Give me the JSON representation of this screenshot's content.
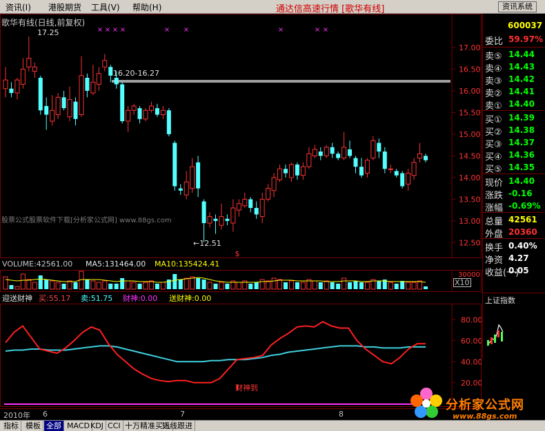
{
  "menu": {
    "items": [
      {
        "label": "资讯(I)",
        "left": 8
      },
      {
        "label": "港股期货",
        "left": 70
      },
      {
        "label": "工具(V)",
        "left": 132
      },
      {
        "label": "帮助(H)",
        "left": 192
      }
    ],
    "app_title": "通达信高速行情 [歌华有线]",
    "info_button": "资讯系统"
  },
  "chart": {
    "title": "歌华有线(日线,前复权)",
    "y_ticks": [
      "17.00",
      "16.50",
      "16.00",
      "15.50",
      "15.00",
      "14.50",
      "14.00",
      "13.50",
      "13.00",
      "12.50"
    ],
    "hi_label": "17.25",
    "lo_label": "←12.51",
    "zone_label": "16.20-16.27",
    "watermark": "股票公式股票软件下载[分析家公式网] www.88gs.com",
    "dollar_marker": "$"
  },
  "volume": {
    "volume": "VOLUME:42561.00",
    "ma5": "MA5:131464.00",
    "ma10": "MA10:135424.41",
    "scale_label": "X10",
    "tick_top": "30000"
  },
  "indicator": {
    "name": "迎送财神",
    "buy": "买:55.17",
    "sell": "卖:51.75",
    "caishen": "财神:0.00",
    "songcaishen": "送财神:0.00",
    "y_ticks": [
      "80.00",
      "60.00",
      "40.00",
      "20.00"
    ],
    "signal_text": "财神到"
  },
  "dates": {
    "year": "2010年",
    "m6": "6",
    "m7": "7",
    "m8": "8"
  },
  "quote": {
    "code": "600037",
    "rows": [
      {
        "label": "委比",
        "value": "59.97%",
        "color": "#ff3030"
      },
      {
        "label": "卖⑤",
        "value": "14.44",
        "color": "#00ff00"
      },
      {
        "label": "卖④",
        "value": "14.43",
        "color": "#00ff00"
      },
      {
        "label": "卖③",
        "value": "14.42",
        "color": "#00ff00"
      },
      {
        "label": "卖②",
        "value": "14.41",
        "color": "#00ff00"
      },
      {
        "label": "卖①",
        "value": "14.40",
        "color": "#00ff00"
      },
      {
        "label": "买①",
        "value": "14.39",
        "color": "#00ff00"
      },
      {
        "label": "买②",
        "value": "14.38",
        "color": "#00ff00"
      },
      {
        "label": "买③",
        "value": "14.37",
        "color": "#00ff00"
      },
      {
        "label": "买④",
        "value": "14.36",
        "color": "#00ff00"
      },
      {
        "label": "买⑤",
        "value": "14.35",
        "color": "#00ff00"
      },
      {
        "label": "现价",
        "value": "14.40",
        "color": "#00ff00"
      },
      {
        "label": "涨跌",
        "value": "-0.16",
        "color": "#00ff00"
      },
      {
        "label": "涨幅",
        "value": "-0.69%",
        "color": "#00ff00"
      },
      {
        "label": "总量",
        "value": "42561",
        "color": "#ffff00"
      },
      {
        "label": "外盘",
        "value": "20360",
        "color": "#ff3030"
      },
      {
        "label": "换手",
        "value": "0.40%",
        "color": "#ffffff"
      },
      {
        "label": "净资",
        "value": "4.27",
        "color": "#ffffff"
      },
      {
        "label": "收益(一)",
        "value": "0.05",
        "color": "#ffffff"
      }
    ]
  },
  "index_panel": {
    "title": "上证指数"
  },
  "logo": {
    "name": "分析家公式网",
    "url": "www.88gs.com"
  },
  "tabs": [
    "指标",
    "模板",
    "全部",
    "MACD",
    "KDJ",
    "CCI",
    "十万精准买入",
    "短线跟进"
  ],
  "colors": {
    "up": "#ff3333",
    "down": "#54ffff",
    "bg": "#000000",
    "grid": "#7a0000",
    "ma_line": "#40d0e0",
    "trade_line": "#ff2020",
    "marker": "#ff33ff"
  },
  "chart_data": {
    "type": "candlestick",
    "x_labels": [
      "2010年",
      "6",
      "7",
      "8"
    ],
    "ylim": [
      12.3,
      17.3
    ],
    "candles": [
      {
        "o": 16.05,
        "c": 16.25,
        "h": 16.55,
        "l": 15.85
      },
      {
        "o": 16.05,
        "c": 15.95,
        "h": 16.2,
        "l": 15.85
      },
      {
        "o": 15.95,
        "c": 16.25,
        "h": 16.3,
        "l": 15.8
      },
      {
        "o": 16.15,
        "c": 16.5,
        "h": 16.75,
        "l": 16.05
      },
      {
        "o": 16.55,
        "c": 16.75,
        "h": 17.25,
        "l": 16.45
      },
      {
        "o": 16.45,
        "c": 16.55,
        "h": 16.65,
        "l": 16.3
      },
      {
        "o": 16.3,
        "c": 15.55,
        "h": 16.35,
        "l": 15.45
      },
      {
        "o": 15.65,
        "c": 15.45,
        "h": 15.85,
        "l": 15.1
      },
      {
        "o": 15.3,
        "c": 15.55,
        "h": 15.9,
        "l": 15.2
      },
      {
        "o": 15.45,
        "c": 15.85,
        "h": 15.95,
        "l": 15.35
      },
      {
        "o": 15.85,
        "c": 15.6,
        "h": 16.0,
        "l": 15.55
      },
      {
        "o": 15.4,
        "c": 15.8,
        "h": 16.1,
        "l": 15.3
      },
      {
        "o": 15.75,
        "c": 15.35,
        "h": 15.85,
        "l": 15.2
      },
      {
        "o": 15.45,
        "c": 16.35,
        "h": 16.8,
        "l": 15.4
      },
      {
        "o": 16.3,
        "c": 16.0,
        "h": 16.4,
        "l": 15.85
      },
      {
        "o": 15.95,
        "c": 16.2,
        "h": 16.6,
        "l": 15.9
      },
      {
        "o": 16.15,
        "c": 16.4,
        "h": 16.55,
        "l": 16.0
      },
      {
        "o": 16.55,
        "c": 16.7,
        "h": 16.85,
        "l": 16.45
      },
      {
        "o": 16.55,
        "c": 16.35,
        "h": 16.6,
        "l": 16.2
      },
      {
        "o": 16.3,
        "c": 16.15,
        "h": 16.45,
        "l": 16.05
      },
      {
        "o": 16.15,
        "c": 15.3,
        "h": 16.2,
        "l": 15.25
      },
      {
        "o": 15.3,
        "c": 15.55,
        "h": 15.65,
        "l": 15.05
      },
      {
        "o": 15.55,
        "c": 15.65,
        "h": 15.7,
        "l": 15.45
      },
      {
        "o": 15.6,
        "c": 15.35,
        "h": 15.65,
        "l": 15.25
      },
      {
        "o": 15.35,
        "c": 15.55,
        "h": 15.6,
        "l": 15.3
      },
      {
        "o": 15.55,
        "c": 15.65,
        "h": 15.75,
        "l": 15.5
      },
      {
        "o": 15.6,
        "c": 15.45,
        "h": 15.7,
        "l": 15.4
      },
      {
        "o": 15.45,
        "c": 15.55,
        "h": 15.65,
        "l": 15.35
      },
      {
        "o": 15.55,
        "c": 15.0,
        "h": 15.6,
        "l": 14.95
      },
      {
        "o": 14.8,
        "c": 13.8,
        "h": 14.85,
        "l": 13.7
      },
      {
        "o": 13.75,
        "c": 13.7,
        "h": 13.85,
        "l": 13.6
      },
      {
        "o": 13.6,
        "c": 13.9,
        "h": 14.15,
        "l": 13.5
      },
      {
        "o": 13.75,
        "c": 14.25,
        "h": 14.45,
        "l": 13.65
      },
      {
        "o": 14.35,
        "c": 13.75,
        "h": 14.5,
        "l": 13.55
      },
      {
        "o": 13.45,
        "c": 12.95,
        "h": 13.5,
        "l": 12.51
      },
      {
        "o": 12.95,
        "c": 13.1,
        "h": 13.2,
        "l": 12.85
      },
      {
        "o": 13.05,
        "c": 13.0,
        "h": 13.15,
        "l": 12.7
      },
      {
        "o": 12.9,
        "c": 13.1,
        "h": 13.4,
        "l": 12.8
      },
      {
        "o": 13.05,
        "c": 13.0,
        "h": 13.15,
        "l": 12.9
      },
      {
        "o": 12.95,
        "c": 13.3,
        "h": 13.5,
        "l": 12.75
      },
      {
        "o": 13.25,
        "c": 13.4,
        "h": 13.5,
        "l": 13.1
      },
      {
        "o": 13.35,
        "c": 13.5,
        "h": 13.65,
        "l": 13.3
      },
      {
        "o": 13.5,
        "c": 13.3,
        "h": 13.55,
        "l": 13.2
      },
      {
        "o": 13.3,
        "c": 13.15,
        "h": 13.45,
        "l": 13.05
      },
      {
        "o": 13.1,
        "c": 13.5,
        "h": 13.65,
        "l": 12.95
      },
      {
        "o": 13.5,
        "c": 13.75,
        "h": 13.85,
        "l": 13.45
      },
      {
        "o": 13.7,
        "c": 14.0,
        "h": 14.1,
        "l": 13.55
      },
      {
        "o": 13.95,
        "c": 14.2,
        "h": 14.3,
        "l": 13.9
      },
      {
        "o": 14.2,
        "c": 14.1,
        "h": 14.3,
        "l": 14.0
      },
      {
        "o": 14.0,
        "c": 14.3,
        "h": 14.35,
        "l": 13.9
      },
      {
        "o": 14.3,
        "c": 14.05,
        "h": 14.35,
        "l": 13.95
      },
      {
        "o": 14.05,
        "c": 14.25,
        "h": 14.35,
        "l": 13.95
      },
      {
        "o": 14.25,
        "c": 14.55,
        "h": 14.7,
        "l": 14.2
      },
      {
        "o": 14.5,
        "c": 14.65,
        "h": 14.75,
        "l": 14.45
      },
      {
        "o": 14.6,
        "c": 14.5,
        "h": 14.7,
        "l": 14.4
      },
      {
        "o": 14.5,
        "c": 14.7,
        "h": 14.75,
        "l": 14.45
      },
      {
        "o": 14.7,
        "c": 14.55,
        "h": 14.8,
        "l": 14.45
      },
      {
        "o": 14.55,
        "c": 14.45,
        "h": 14.6,
        "l": 14.4
      },
      {
        "o": 14.45,
        "c": 14.7,
        "h": 15.05,
        "l": 14.4
      },
      {
        "o": 14.65,
        "c": 14.5,
        "h": 14.85,
        "l": 14.45
      },
      {
        "o": 14.45,
        "c": 14.25,
        "h": 14.5,
        "l": 14.1
      },
      {
        "o": 14.25,
        "c": 14.05,
        "h": 14.45,
        "l": 14.0
      },
      {
        "o": 14.1,
        "c": 14.4,
        "h": 14.45,
        "l": 14.0
      },
      {
        "o": 14.45,
        "c": 14.85,
        "h": 14.95,
        "l": 14.4
      },
      {
        "o": 14.8,
        "c": 14.6,
        "h": 14.9,
        "l": 14.45
      },
      {
        "o": 14.6,
        "c": 14.2,
        "h": 14.7,
        "l": 14.1
      },
      {
        "o": 14.2,
        "c": 14.2,
        "h": 14.3,
        "l": 14.1
      },
      {
        "o": 14.15,
        "c": 14.05,
        "h": 14.2,
        "l": 14.0
      },
      {
        "o": 14.1,
        "c": 13.8,
        "h": 14.15,
        "l": 13.75
      },
      {
        "o": 13.85,
        "c": 14.1,
        "h": 14.2,
        "l": 13.7
      },
      {
        "o": 14.05,
        "c": 14.35,
        "h": 14.45,
        "l": 13.95
      },
      {
        "o": 14.45,
        "c": 14.55,
        "h": 14.8,
        "l": 14.35
      },
      {
        "o": 14.5,
        "c": 14.4,
        "h": 14.55,
        "l": 14.35
      }
    ],
    "volumes": [
      18,
      6,
      4,
      22,
      14,
      10,
      20,
      14,
      12,
      10,
      8,
      12,
      10,
      28,
      14,
      12,
      10,
      12,
      8,
      8,
      16,
      12,
      10,
      8,
      10,
      12,
      8,
      10,
      14,
      22,
      14,
      16,
      18,
      16,
      14,
      10,
      8,
      10,
      8,
      12,
      10,
      12,
      8,
      10,
      14,
      12,
      16,
      14,
      10,
      12,
      10,
      10,
      14,
      12,
      10,
      12,
      10,
      8,
      16,
      10,
      12,
      10,
      10,
      14,
      12,
      14,
      10,
      8,
      12,
      10,
      10,
      12,
      4
    ],
    "ma5_line": [
      14,
      13,
      12,
      13,
      13,
      14,
      15,
      14,
      13,
      12,
      11,
      11,
      11,
      14,
      14,
      14,
      14,
      13,
      12,
      11,
      12,
      12,
      12,
      11,
      11,
      11,
      10,
      10,
      11,
      13,
      14,
      15,
      16,
      17,
      16,
      14,
      12,
      11,
      10,
      10,
      10,
      10,
      10,
      10,
      11,
      11,
      12,
      13,
      13,
      13,
      12,
      12,
      12,
      12,
      12,
      11,
      11,
      11,
      12,
      12,
      12,
      11,
      11,
      12,
      12,
      12,
      11,
      11,
      11,
      11,
      11,
      11,
      10
    ],
    "indicator_buy": [
      58,
      68,
      74,
      63,
      52,
      50,
      48,
      53,
      60,
      68,
      73,
      70,
      57,
      47,
      40,
      33,
      28,
      24,
      22,
      21,
      22,
      22,
      20,
      20,
      20,
      24,
      33,
      42,
      43,
      44,
      46,
      56,
      62,
      67,
      73,
      74,
      73,
      78,
      74,
      72,
      72,
      60,
      52,
      46,
      40,
      38,
      44,
      52,
      57,
      57
    ],
    "indicator_sell": [
      50,
      51,
      51,
      52,
      52,
      51,
      51,
      51,
      52,
      53,
      54,
      55,
      55,
      54,
      52,
      50,
      48,
      46,
      44,
      42,
      40,
      40,
      40,
      40,
      41,
      41,
      42,
      42,
      42,
      43,
      44,
      46,
      47,
      49,
      50,
      51,
      52,
      53,
      54,
      55,
      55,
      55,
      54,
      54,
      53,
      53,
      53,
      54,
      54,
      54
    ]
  }
}
